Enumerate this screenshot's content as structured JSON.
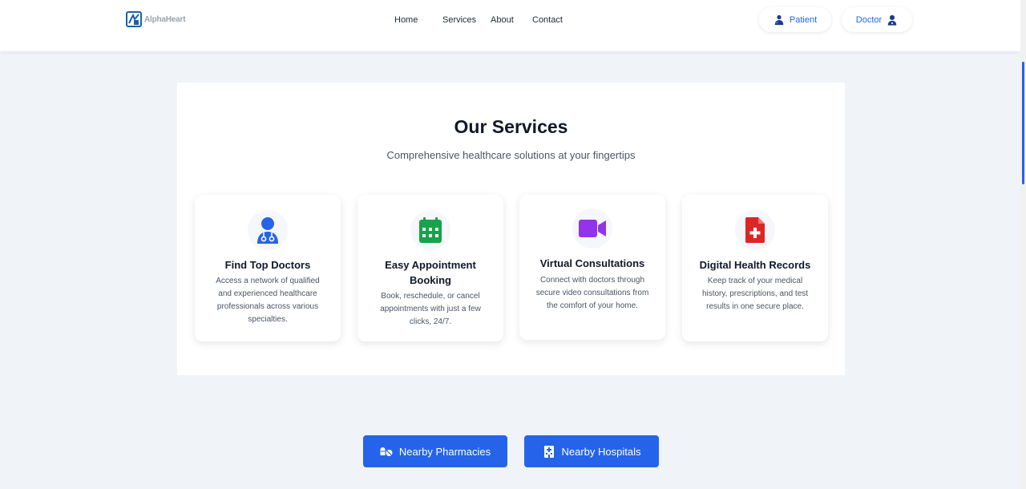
{
  "brand": {
    "name": "AlphaHeart"
  },
  "nav": {
    "home": "Home",
    "services": "Services",
    "about": "About",
    "contact": "Contact"
  },
  "roles": {
    "patient": "Patient",
    "doctor": "Doctor"
  },
  "services": {
    "title": "Our Services",
    "subtitle": "Comprehensive healthcare solutions at your fingertips",
    "cards": [
      {
        "icon": "doctor-icon",
        "title": "Find Top Doctors",
        "description": "Access a network of qualified and experienced healthcare professionals across various specialties."
      },
      {
        "icon": "calendar-icon",
        "title": "Easy Appointment Booking",
        "description": "Book, reschedule, or cancel appointments with just a few clicks, 24/7."
      },
      {
        "icon": "video-icon",
        "title": "Virtual Consultations",
        "description": "Connect with doctors through secure video consultations from the comfort of your home."
      },
      {
        "icon": "medical-file-icon",
        "title": "Digital Health Records",
        "description": "Keep track of your medical history, prescriptions, and test results in one secure place."
      }
    ]
  },
  "actions": {
    "pharmacies": "Nearby Pharmacies",
    "hospitals": "Nearby Hospitals"
  },
  "colors": {
    "accent": "#2563eb",
    "doctor_icon": "#2563eb",
    "calendar_icon": "#16a34a",
    "video_icon": "#9333ea",
    "file_icon": "#dc2626",
    "page_bg": "#f0f4f9"
  }
}
